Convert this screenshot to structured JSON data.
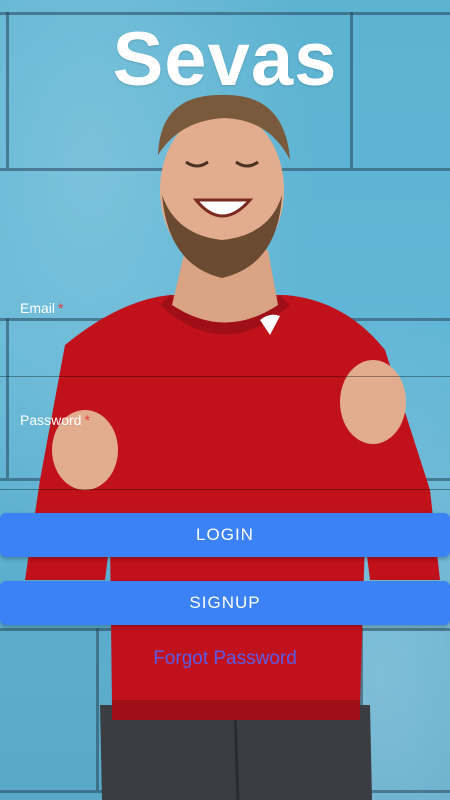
{
  "app": {
    "brand": "Sevas"
  },
  "form": {
    "email_label": "Email",
    "email_value": "",
    "password_label": "Password",
    "password_value": "",
    "required_mark": "*",
    "login_label": "LOGIN",
    "signup_label": "SIGNUP",
    "forgot_label": "Forgot Password"
  },
  "colors": {
    "button": "#3b82f6",
    "link": "#5b5ce6",
    "required": "#e53935"
  }
}
